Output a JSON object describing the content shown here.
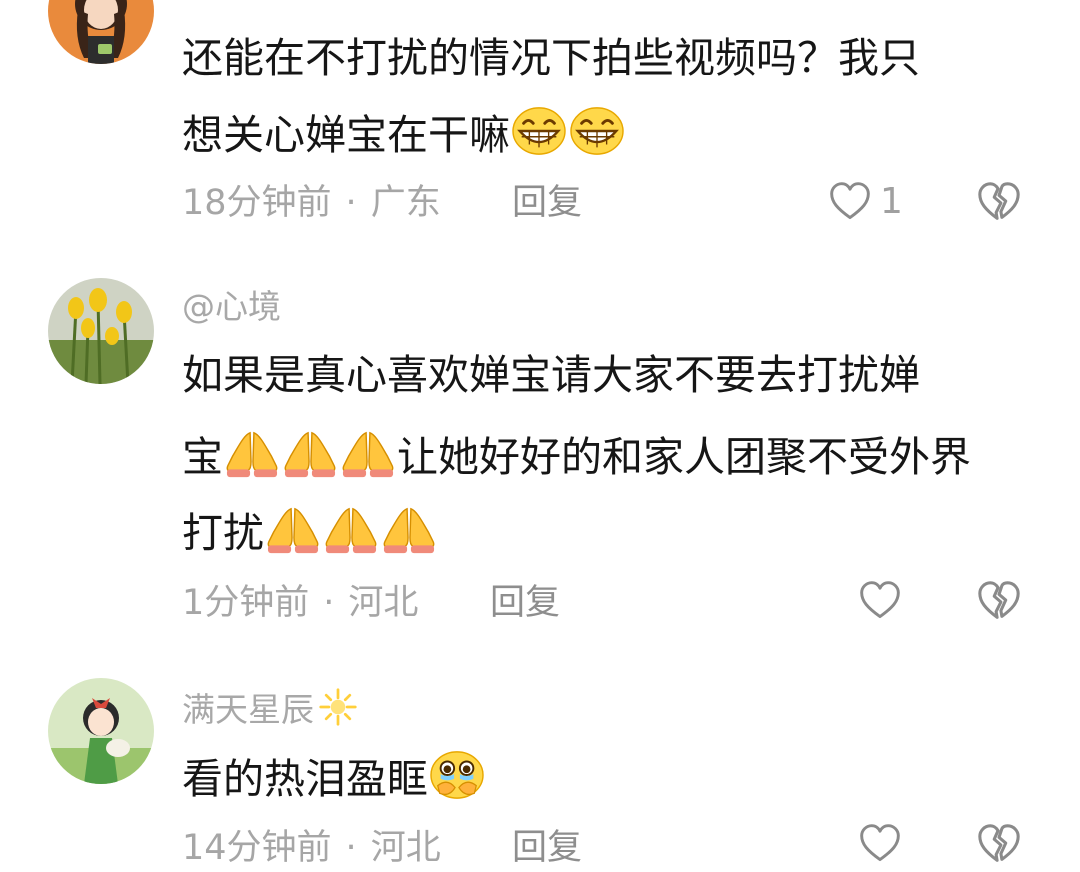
{
  "comments": [
    {
      "username": "",
      "text_lines": [
        "还能在不打扰的情况下拍些视频吗？我只",
        "想关心婵宝在干嘛"
      ],
      "line_emojis": [
        [],
        [
          "grin-emoji",
          "grin-emoji"
        ]
      ],
      "time": "18分钟前",
      "location": "广东",
      "reply_label": "回复",
      "like_count": "1"
    },
    {
      "username": "@心境",
      "text_lines": [
        "如果是真心喜欢婵宝请大家不要去打扰婵",
        "宝",
        "让她好好的和家人团聚不受外界",
        "打扰"
      ],
      "time": "1分钟前",
      "location": "河北",
      "reply_label": "回复",
      "like_count": ""
    },
    {
      "username": "满天星辰",
      "text_lines": [
        "看的热泪盈眶"
      ],
      "time": "14分钟前",
      "location": "河北",
      "reply_label": "回复",
      "like_count": ""
    }
  ],
  "separator": "·",
  "icons": {
    "like": "heart-outline-icon",
    "dislike": "broken-heart-icon",
    "emoji_grin": "grin-emoji",
    "emoji_pray": "folded-hands-emoji",
    "emoji_sparkle": "sparkle-emoji",
    "emoji_tears": "holding-back-tears-emoji"
  },
  "colors": {
    "text": "#161616",
    "muted": "#a6a6a6",
    "reply": "#8e8e8e",
    "icon_stroke": "#8a8a8a"
  }
}
